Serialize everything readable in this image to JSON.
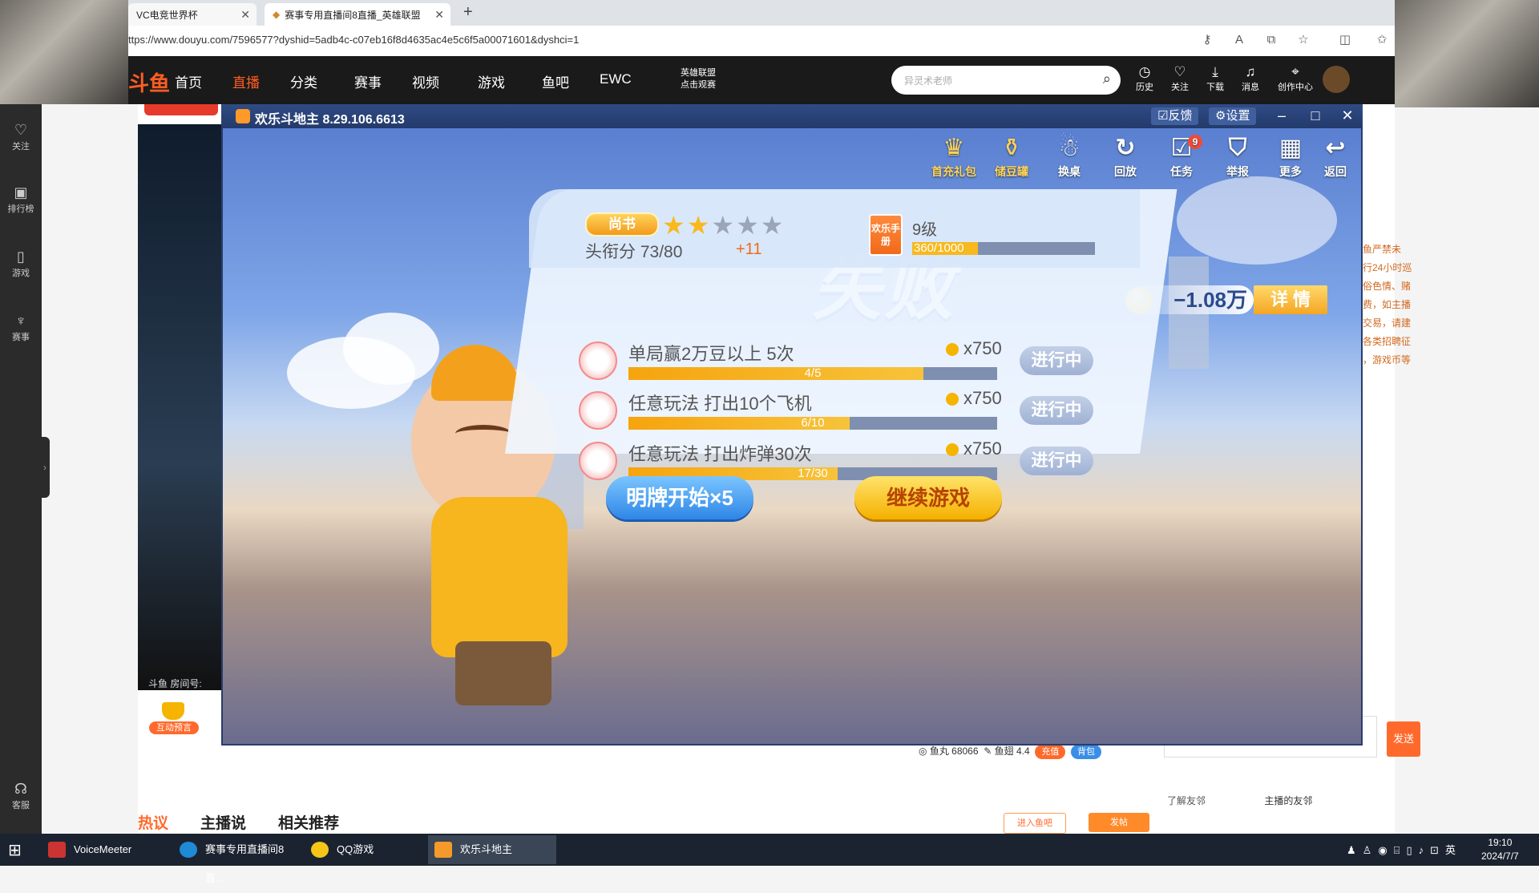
{
  "browser": {
    "tabs": [
      {
        "title": "VC电竞世界杯"
      },
      {
        "title": "赛事专用直播间8直播_英雄联盟"
      }
    ],
    "new_tab": "+",
    "url": "ttps://www.douyu.com/7596577?dyshid=5adb4c-c07eb16f8d4635ac4e5c6f5a00071601&dyshci=1"
  },
  "site": {
    "logo": "斗鱼",
    "nav": [
      "首页",
      "直播",
      "分类",
      "赛事",
      "视频",
      "游戏",
      "鱼吧",
      "EWC"
    ],
    "event_badge": [
      "英雄联盟",
      "点击观赛"
    ],
    "search_placeholder": "异灵术老师",
    "header_icons": [
      "历史",
      "关注",
      "下载",
      "消息",
      "创作中心"
    ],
    "sidebar": [
      "关注",
      "排行榜",
      "游戏",
      "赛事",
      "客服"
    ],
    "room_label": "斗鱼 房间号:",
    "interact_label": "互动预言",
    "right_notice": [
      "鱼严禁未",
      "行24小时巡",
      "俗色情、赌",
      "费，如主播",
      "交易，请建",
      "各类招聘征",
      "，游戏币等"
    ],
    "stats": {
      "fishball": "鱼丸 68066",
      "fishwing": "鱼翅 4.4",
      "recharge": "充值",
      "bag": "背包"
    },
    "send": "发送",
    "friends_label": "了解友邻",
    "friends_title": "主播的友邻",
    "bottom_tabs": [
      "热议",
      "主播说",
      "相关推荐"
    ],
    "bottom_buttons": [
      "进入鱼吧",
      "发帖"
    ]
  },
  "game": {
    "window_title": "欢乐斗地主 8.29.106.6613",
    "title_buttons": [
      "反馈",
      "设置"
    ],
    "toolbar": [
      {
        "label": "首充礼包",
        "icon": "gift-bag-icon"
      },
      {
        "label": "储豆罐",
        "icon": "piggy-bank-icon"
      },
      {
        "label": "换桌",
        "icon": "ghost-icon"
      },
      {
        "label": "回放",
        "icon": "replay-icon"
      },
      {
        "label": "任务",
        "icon": "task-icon",
        "badge": "9"
      },
      {
        "label": "举报",
        "icon": "police-cap-icon"
      },
      {
        "label": "更多",
        "icon": "grid-icon"
      },
      {
        "label": "返回",
        "icon": "back-arrow-icon"
      }
    ],
    "result": "失败",
    "loss_amount": "−1.08万",
    "detail_button": "详 情",
    "rank_title": "尚书",
    "stars_on": 2,
    "stars_total": 5,
    "rank_score": "头衔分 73/80",
    "rank_plus": "+11",
    "manual_label": "欢乐手册",
    "level": "9级",
    "level_progress_text": "360/1000",
    "level_progress": 0.36,
    "tasks": [
      {
        "name": "单局赢2万豆以上 5次",
        "reward": "x750",
        "progress_text": "4/5",
        "progress": 0.8,
        "status": "进行中"
      },
      {
        "name": "任意玩法 打出10个飞机",
        "reward": "x750",
        "progress_text": "6/10",
        "progress": 0.6,
        "status": "进行中"
      },
      {
        "name": "任意玩法 打出炸弹30次",
        "reward": "x750",
        "progress_text": "17/30",
        "progress": 0.567,
        "status": "进行中"
      }
    ],
    "button_show_cards": "明牌开始×5",
    "button_continue": "继续游戏"
  },
  "taskbar": {
    "apps": [
      "VoiceMeeter",
      "赛事专用直播间8直...",
      "QQ游戏",
      "欢乐斗地主"
    ],
    "ime": "英",
    "time": "19:10",
    "date": "2024/7/7"
  }
}
